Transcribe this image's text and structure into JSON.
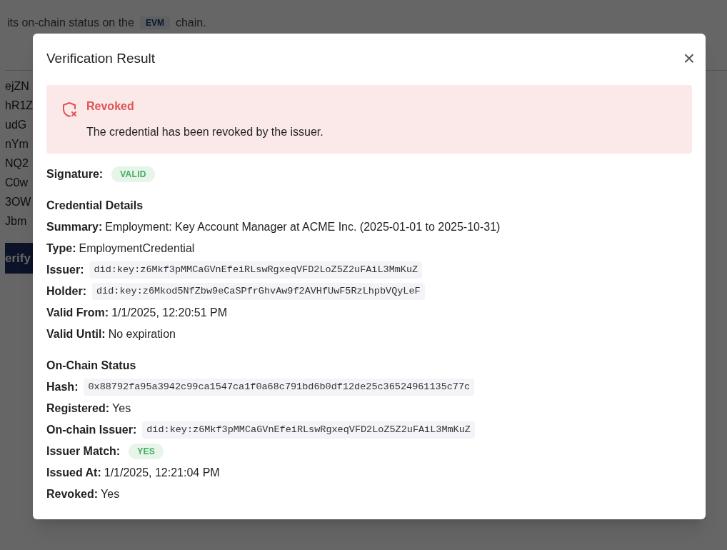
{
  "background": {
    "notice": {
      "before": "its on-chain status on the",
      "chip": "EVM",
      "after": "chain."
    },
    "fragments": [
      "ejZN",
      "hR1Z",
      "udG",
      "nYm",
      "NQ2",
      "C0w",
      "3OW",
      "Jbm"
    ],
    "button": "erify"
  },
  "dialog": {
    "title": "Verification Result",
    "close": "×",
    "alert": {
      "title": "Revoked",
      "message": "The credential has been revoked by the issuer."
    },
    "sections": [
      {
        "rows": [
          {
            "label": "Signature:",
            "kind": "badge",
            "value": "VALID"
          }
        ]
      },
      {
        "heading": "Credential Details",
        "rows": [
          {
            "label": "Summary:",
            "kind": "text",
            "value": "Employment: Key Account Manager at ACME Inc. (2025-01-01 to 2025-10-31)"
          },
          {
            "label": "Type:",
            "kind": "text",
            "value": "EmploymentCredential"
          },
          {
            "label": "Issuer:",
            "kind": "code",
            "value": "did:key:z6Mkf3pMMCaGVnEfeiRLswRgxeqVFD2LoZ5Z2uFAiL3MmKuZ"
          },
          {
            "label": "Holder:",
            "kind": "code",
            "value": "did:key:z6Mkod5NfZbw9eCaSPfrGhvAw9f2AVHfUwF5RzLhpbVQyLeF"
          },
          {
            "label": "Valid From:",
            "kind": "text",
            "value": "1/1/2025, 12:20:51 PM"
          },
          {
            "label": "Valid Until:",
            "kind": "text",
            "value": "No expiration"
          }
        ]
      },
      {
        "heading": "On-Chain Status",
        "rows": [
          {
            "label": "Hash:",
            "kind": "code",
            "value": "0x88792fa95a3942c99ca1547ca1f0a68c791bd6b0df12de25c36524961135c77c"
          },
          {
            "label": "Registered:",
            "kind": "text",
            "value": "Yes"
          },
          {
            "label": "On-chain Issuer:",
            "kind": "code",
            "value": "did:key:z6Mkf3pMMCaGVnEfeiRLswRgxeqVFD2LoZ5Z2uFAiL3MmKuZ"
          },
          {
            "label": "Issuer Match:",
            "kind": "badge",
            "value": "YES"
          },
          {
            "label": "Issued At:",
            "kind": "text",
            "value": "1/1/2025, 12:21:04 PM"
          },
          {
            "label": "Revoked:",
            "kind": "text",
            "value": "Yes"
          }
        ]
      }
    ]
  }
}
